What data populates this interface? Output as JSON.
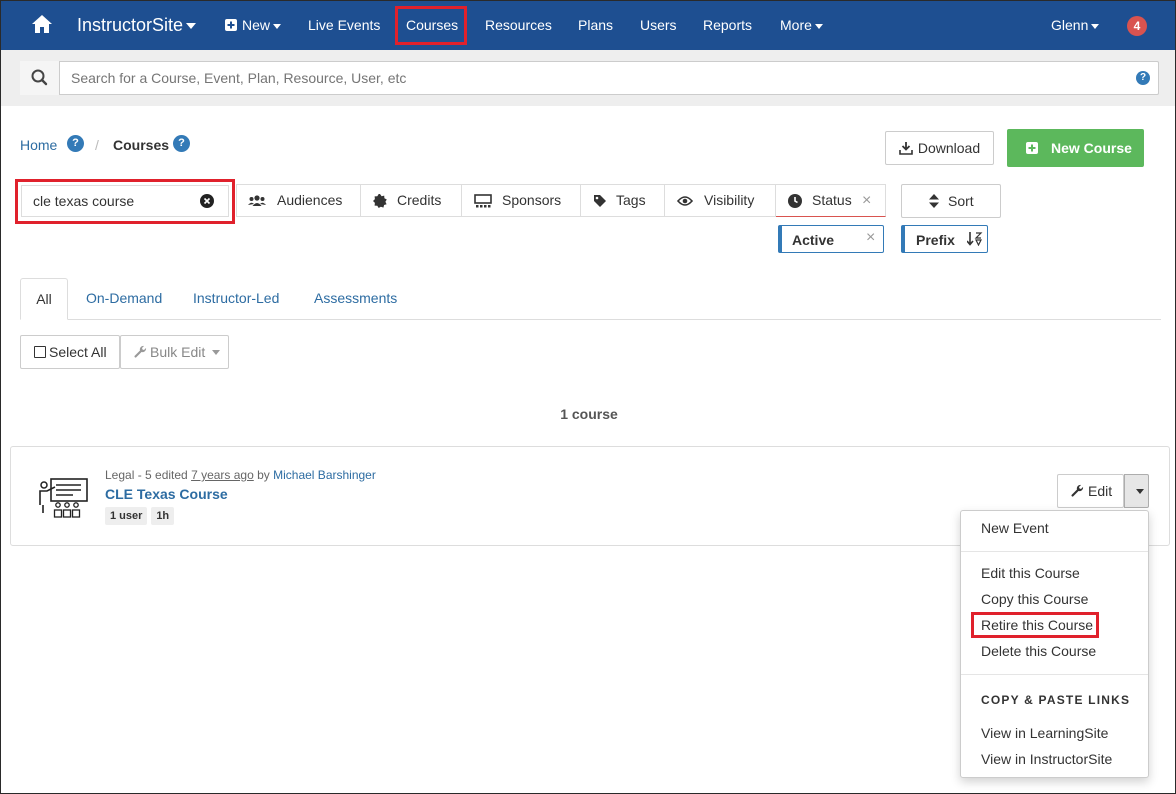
{
  "nav": {
    "brand": "InstructorSite",
    "new": "New",
    "live_events": "Live Events",
    "courses": "Courses",
    "resources": "Resources",
    "plans": "Plans",
    "users": "Users",
    "reports": "Reports",
    "more": "More",
    "user": "Glenn",
    "notifications": "4"
  },
  "search": {
    "placeholder": "Search for a Course, Event, Plan, Resource, User, etc",
    "help": "?"
  },
  "breadcrumb": {
    "home": "Home",
    "current": "Courses",
    "help": "?"
  },
  "actions": {
    "download": "Download",
    "new_course": "New Course"
  },
  "filters": {
    "query": "cle texas course",
    "audiences": "Audiences",
    "credits": "Credits",
    "sponsors": "Sponsors",
    "tags": "Tags",
    "visibility": "Visibility",
    "status": "Status",
    "status_value": "Active",
    "sort": "Sort",
    "sort_value": "Prefix"
  },
  "tabs": [
    "All",
    "On-Demand",
    "Instructor-Led",
    "Assessments"
  ],
  "toolbar": {
    "select_all": "Select All",
    "bulk_edit": "Bulk Edit"
  },
  "results_count": "1 course",
  "course": {
    "meta_prefix": "Legal - 5 edited ",
    "meta_time": "7 years ago",
    "meta_by": " by ",
    "author": "Michael Barshinger",
    "title": "CLE Texas Course",
    "badge_users": "1 user",
    "badge_duration": "1h",
    "edit": "Edit"
  },
  "menu": {
    "new_event": "New Event",
    "edit": "Edit this Course",
    "copy": "Copy this Course",
    "retire": "Retire this Course",
    "delete": "Delete this Course",
    "header": "COPY & PASTE LINKS",
    "view_learning": "View in LearningSite",
    "view_instructor": "View in InstructorSite"
  },
  "colors": {
    "nav": "#1e4f91",
    "green": "#5cb85c",
    "highlight": "#e0212c",
    "link": "#2d6ca2",
    "status_underline": "#d9534f"
  }
}
